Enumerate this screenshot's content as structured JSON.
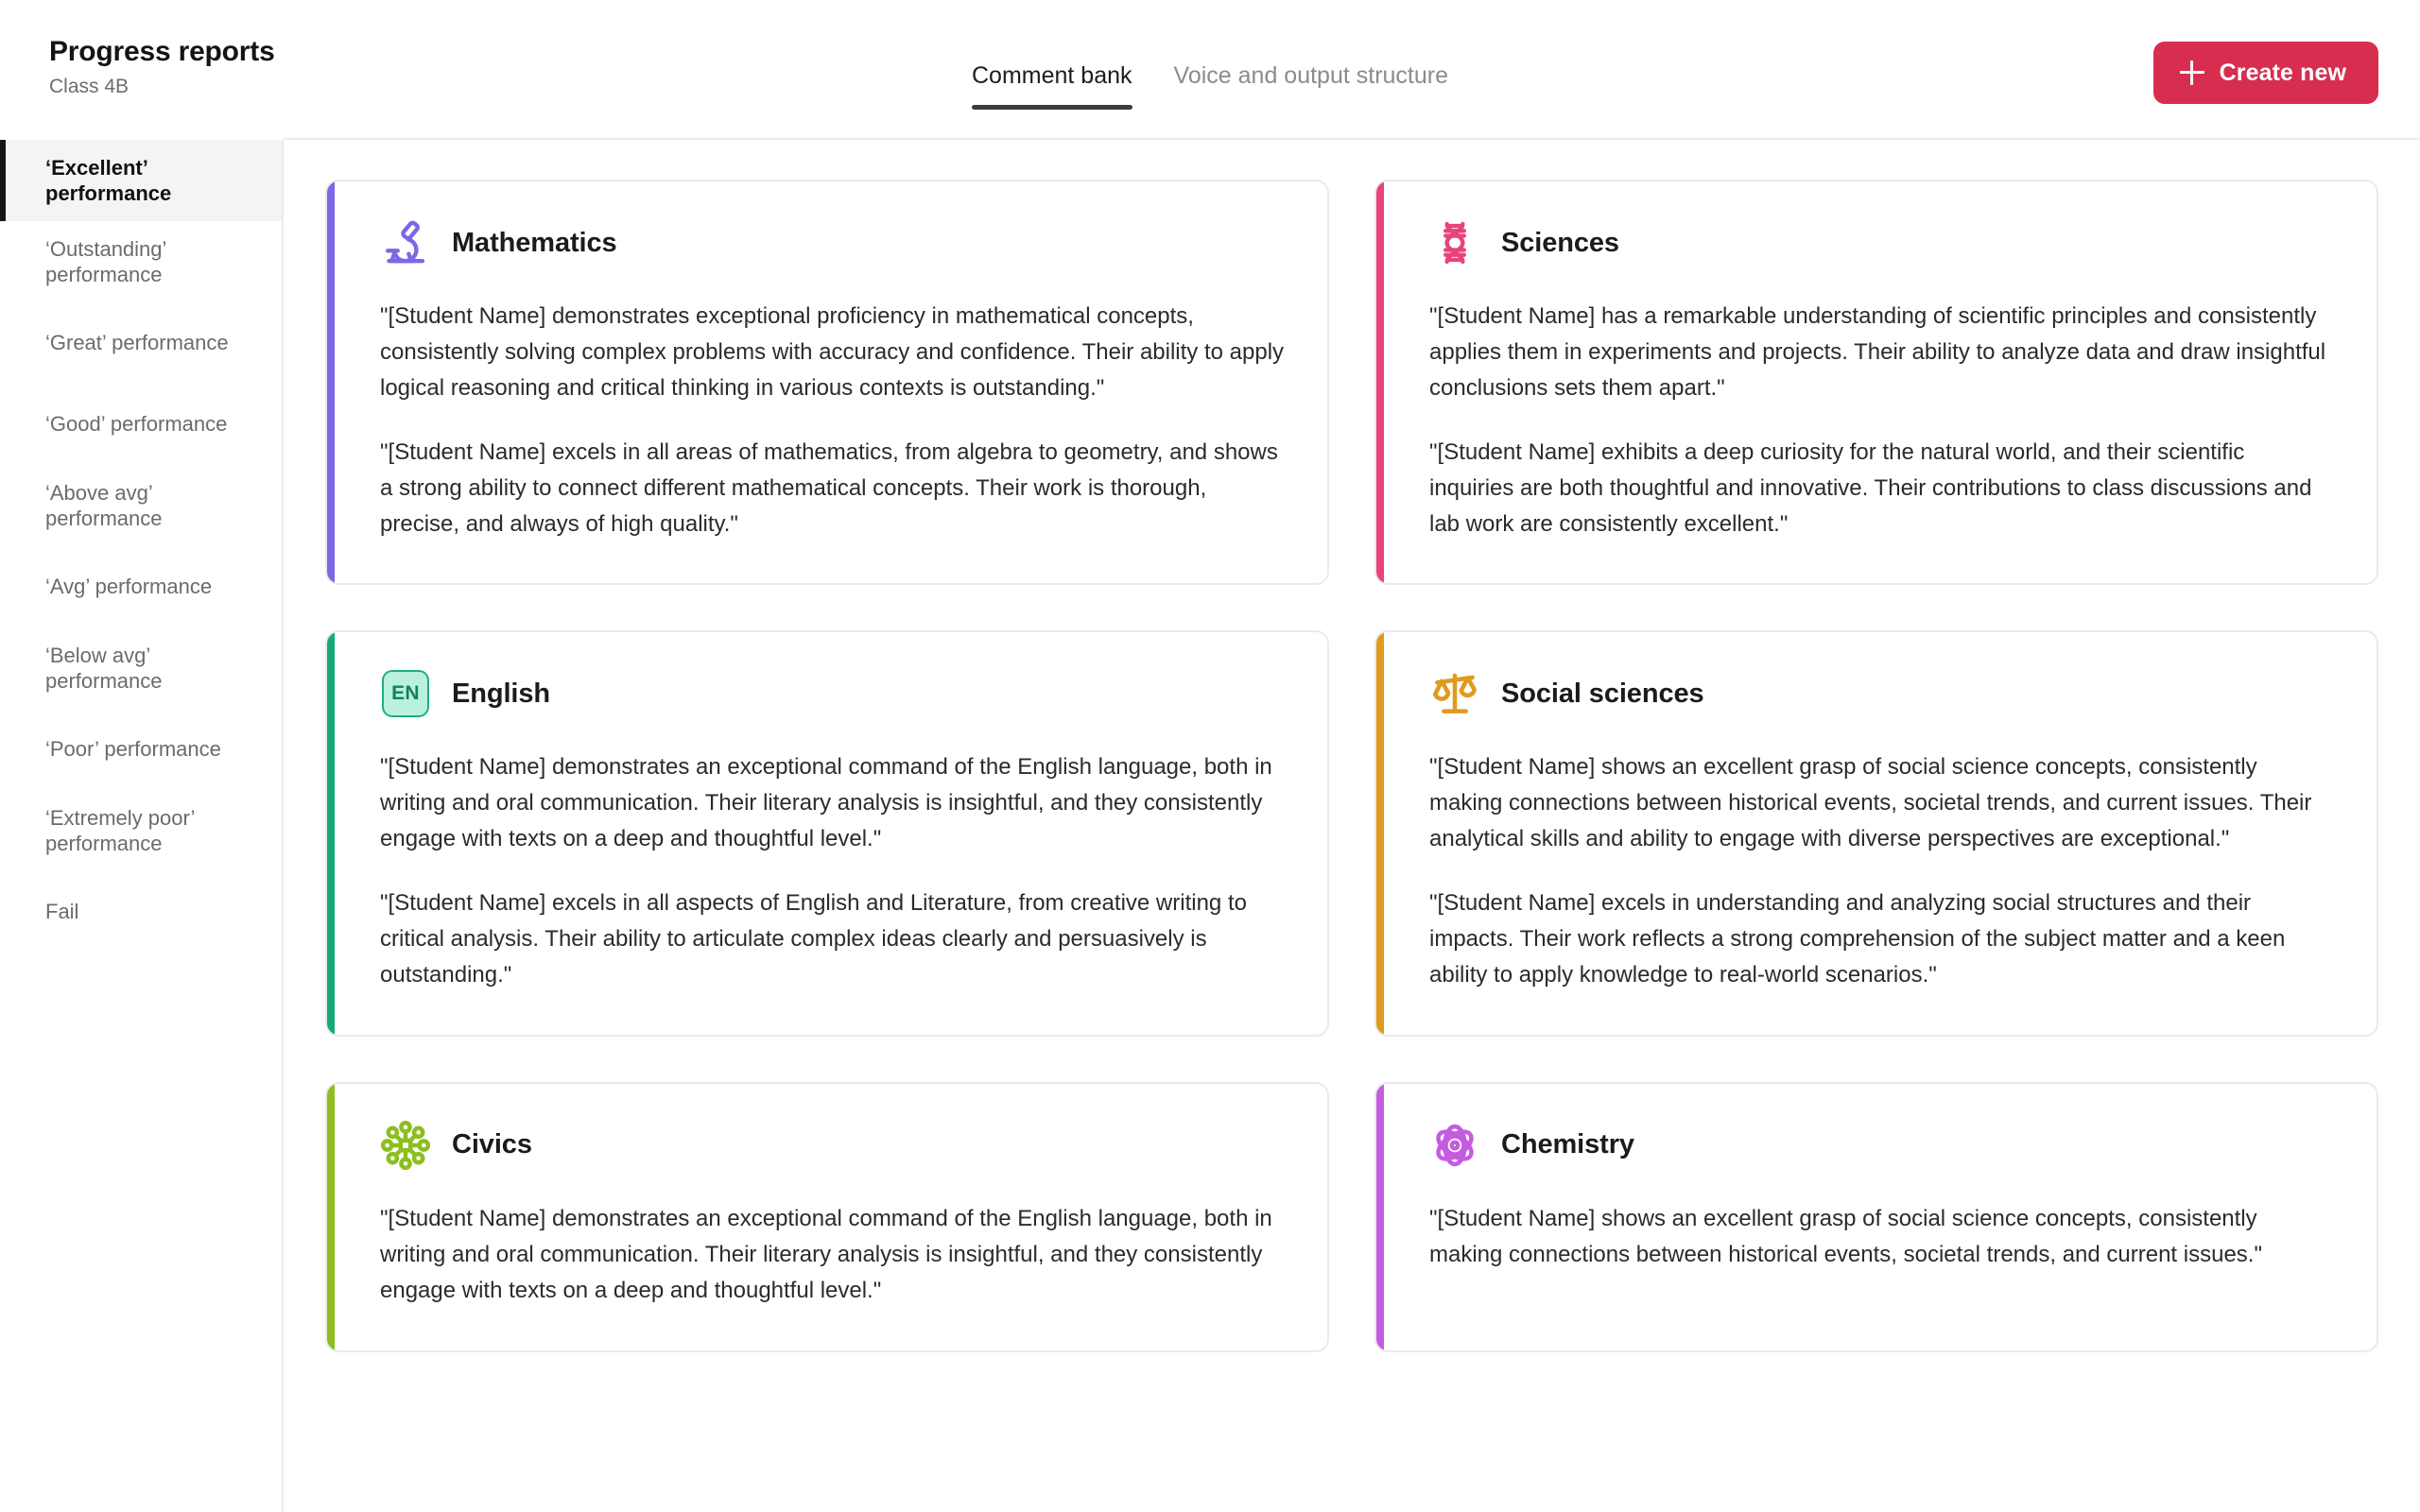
{
  "header": {
    "title": "Progress reports",
    "subtitle": "Class 4B",
    "tabs": [
      {
        "label": "Comment bank",
        "active": true
      },
      {
        "label": "Voice and output structure",
        "active": false
      }
    ],
    "create_button": {
      "label": "Create new",
      "icon": "plus-icon",
      "color": "#d72e50"
    }
  },
  "sidebar": {
    "items": [
      {
        "label": "‘Excellent’ performance",
        "active": true
      },
      {
        "label": "‘Outstanding’ performance",
        "active": false
      },
      {
        "label": "‘Great’ performance",
        "active": false
      },
      {
        "label": "‘Good’ performance",
        "active": false
      },
      {
        "label": "‘Above avg’ performance",
        "active": false
      },
      {
        "label": "‘Avg’ performance",
        "active": false
      },
      {
        "label": "‘Below avg’ performance",
        "active": false
      },
      {
        "label": "‘Poor’ performance",
        "active": false
      },
      {
        "label": "‘Extremely poor’ performance",
        "active": false
      },
      {
        "label": "Fail",
        "active": false
      }
    ]
  },
  "cards": [
    {
      "title": "Mathematics",
      "icon": "microscope-icon",
      "accent_color": "#7a68e8",
      "paragraphs": [
        "\"[Student Name] demonstrates exceptional proficiency in mathematical concepts, consistently solving complex problems with accuracy and confidence. Their ability to apply logical reasoning and critical thinking in various contexts is outstanding.\"",
        "\"[Student Name] excels in all areas of mathematics, from algebra to geometry, and shows a strong ability to connect different mathematical concepts. Their work is thorough, precise, and always of high quality.\""
      ]
    },
    {
      "title": "Sciences",
      "icon": "dna-icon",
      "accent_color": "#e8437a",
      "paragraphs": [
        "\"[Student Name] has a remarkable understanding of scientific principles and consistently applies them in experiments and projects. Their ability to analyze data and draw insightful conclusions sets them apart.\"",
        "\"[Student Name] exhibits a deep curiosity for the natural world, and their scientific inquiries are both thoughtful and innovative. Their contributions to class discussions and lab work are consistently excellent.\""
      ]
    },
    {
      "title": "English",
      "icon": "en-badge-icon",
      "badge_text": "EN",
      "accent_color": "#17a97c",
      "paragraphs": [
        "\"[Student Name] demonstrates an exceptional command of the English language, both in writing and oral communication. Their literary analysis is insightful, and they consistently engage with texts on a deep and thoughtful level.\"",
        "\"[Student Name] excels in all aspects of English and Literature, from creative writing to critical analysis. Their ability to articulate complex ideas clearly and persuasively is outstanding.\""
      ]
    },
    {
      "title": "Social sciences",
      "icon": "scales-icon",
      "accent_color": "#e09a1e",
      "paragraphs": [
        "\"[Student Name] shows an excellent grasp of social science concepts, consistently making connections between historical events, societal trends, and current issues. Their analytical skills and ability to engage with diverse perspectives are exceptional.\"",
        "\"[Student Name] excels in understanding and analyzing social structures and their impacts. Their work reflects a strong comprehension of the subject matter and a keen ability to apply knowledge to real-world scenarios.\""
      ]
    },
    {
      "title": "Civics",
      "icon": "network-nodes-icon",
      "accent_color": "#8cbf1f",
      "paragraphs": [
        "\"[Student Name] demonstrates an exceptional command of the English language, both in writing and oral communication. Their literary analysis is insightful, and they consistently engage with texts on a deep and thoughtful level.\""
      ]
    },
    {
      "title": "Chemistry",
      "icon": "atom-icon",
      "accent_color": "#c45ce0",
      "paragraphs": [
        "\"[Student Name] shows an excellent grasp of social science concepts, consistently making connections between historical events, societal trends, and current issues.\""
      ]
    }
  ]
}
